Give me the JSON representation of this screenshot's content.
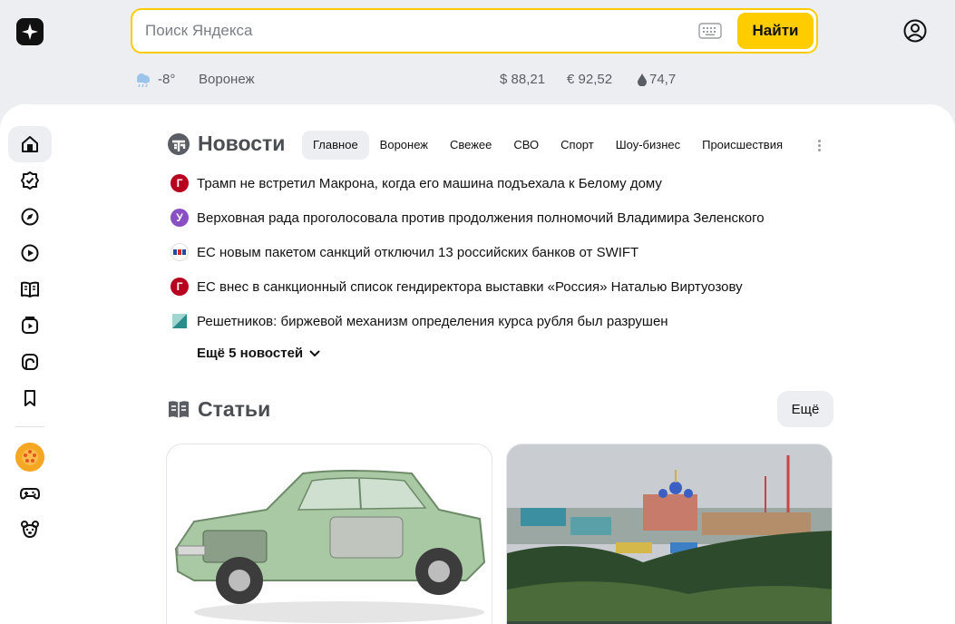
{
  "search": {
    "placeholder": "Поиск Яндекса",
    "button_label": "Найти"
  },
  "info": {
    "temperature": "-8°",
    "city": "Воронеж",
    "usd": "$ 88,21",
    "eur": "€ 92,52",
    "oil": "74,7"
  },
  "sidebar": {
    "items": [
      "home",
      "tasks",
      "discover",
      "video",
      "reader",
      "tv",
      "market",
      "bookmarks",
      "orange-app",
      "games",
      "kids"
    ]
  },
  "news": {
    "title": "Новости",
    "tabs": [
      "Главное",
      "Воронеж",
      "Свежее",
      "СВО",
      "Спорт",
      "Шоу-бизнес",
      "Происшествия"
    ],
    "items": [
      {
        "text": "Трамп не встретил Макрона, когда его машина подъехала к Белому дому",
        "source_color": "#b8001f",
        "source_letter": "Г"
      },
      {
        "text": "Верховная рада проголосовала против продолжения полномочий Владимира Зеленского",
        "source_color": "#8a4fc3",
        "source_letter": "У"
      },
      {
        "text": "ЕС новым пакетом санкций отключил 13 российских банков от SWIFT",
        "source_color": "#ffffff",
        "source_letter": ""
      },
      {
        "text": "ЕС внес в санкционный список гендиректора выставки «Россия» Наталью Виртуозову",
        "source_color": "#b8001f",
        "source_letter": "Г"
      },
      {
        "text": "Решетников: биржевой механизм определения курса рубля был разрушен",
        "source_color": "#2b8c8c",
        "source_letter": ""
      }
    ],
    "more_label": "Ещё 5 новостей"
  },
  "articles": {
    "title": "Статьи",
    "more_label": "Ещё"
  },
  "colors": {
    "accent": "#ffcc00",
    "page_bg": "#eceef2"
  }
}
